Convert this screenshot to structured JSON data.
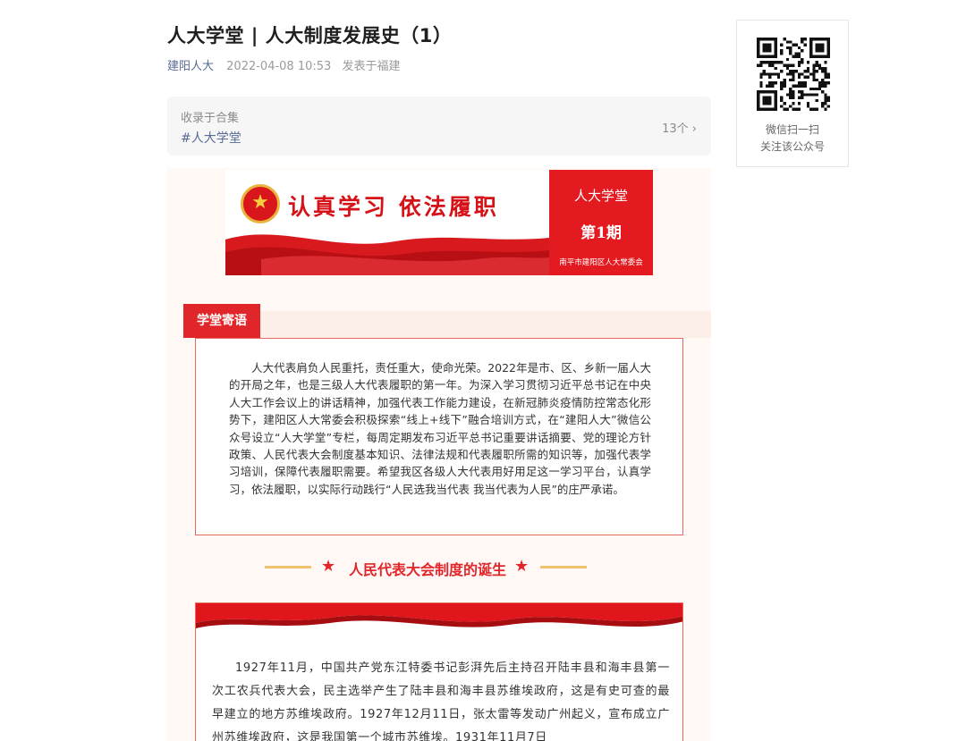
{
  "article": {
    "title": "人大学堂 | 人大制度发展史（1）",
    "author": "建阳人大",
    "time": "2022-04-08 10:53",
    "location": "发表于福建"
  },
  "album": {
    "label": "收录于合集",
    "tag": "#人大学堂",
    "count": "13个 ›"
  },
  "banner": {
    "slogan": "认真学习  依法履职",
    "side_title": "人大学堂",
    "issue": "第1期",
    "org": "南平市建阳区人大常委会",
    "accent": "#e31b20"
  },
  "section": {
    "tab": "学堂寄语",
    "intro": "人大代表肩负人民重托，责任重大，使命光荣。2022年是市、区、乡新一届人大的开局之年，也是三级人大代表履职的第一年。为深入学习贯彻习近平总书记在中央人大工作会议上的讲话精神，加强代表工作能力建设，在新冠肺炎疫情防控常态化形势下，建阳区人大常委会积极探索“线上+线下”融合培训方式，在“建阳人大”微信公众号设立“人大学堂”专栏，每周定期发布习近平总书记重要讲话摘要、党的理论方针政策、人民代表大会制度基本知识、法律法规和代表履职所需的知识等，加强代表学习培训，保障代表履职需要。希望我区各级人大代表用好用足这一学习平台，认真学习，依法履职，以实际行动践行“人民选我当代表  我当代表为人民”的庄严承诺。"
  },
  "heading": {
    "star": "★",
    "text": "人民代表大会制度的诞生"
  },
  "history": {
    "text": "1927年11月，中国共产党东江特委书记彭湃先后主持召开陆丰县和海丰县第一次工农兵代表大会，民主选举产生了陆丰县和海丰县苏维埃政府，这是有史可查的最早建立的地方苏维埃政府。1927年12月11日，张太雷等发动广州起义，宣布成立广州苏维埃政府，这是我国第一个城市苏维埃。1931年11月7日"
  },
  "qr": {
    "caption1": "微信扫一扫",
    "caption2": "关注该公众号"
  }
}
